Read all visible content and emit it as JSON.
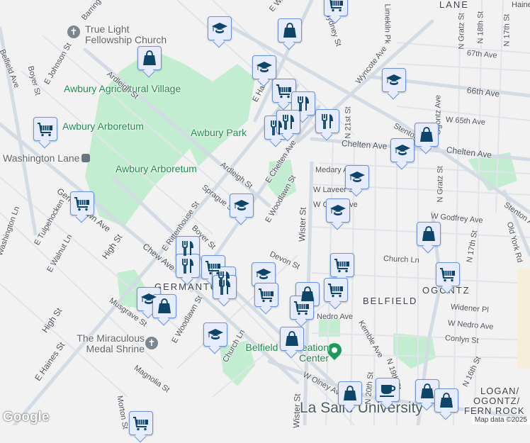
{
  "map": {
    "attribution": "Map data ©2025",
    "logo": "Google",
    "colors": {
      "background": "#f3f2f3",
      "park": "#c3edd0",
      "road": "#d6dde6",
      "marker_fill": "#e6ecfb",
      "marker_border": "#6a93dc",
      "icon": "#0c4568"
    },
    "pois": {
      "church1": "True Light Fellowship Church",
      "church2": "The Miraculous Medal Shrine",
      "rec": "Belfield Recreation Center",
      "station": "Washington Lane",
      "university": "La Salle University"
    },
    "parks": {
      "village": "Awbury Agricultural Village",
      "arboretum1": "Awbury Arboretum",
      "arboretum2": "Awbury Arboretum",
      "park": "Awbury Park"
    },
    "areas": {
      "germantown": "GERMANTOWN",
      "belfield": "BELFIELD",
      "ogontz": "OGONTZ",
      "lane": "LANE",
      "logan1": "LOGAN/",
      "logan2": "OGONTZ/",
      "logan3": "FERN ROCK"
    },
    "streets": {
      "barring": "Barring",
      "ewalnut_top": "E Walnut",
      "sydney": "Sydney St",
      "limekiln": "Limekiln Pk",
      "haines_top": "Haines",
      "belfield": "Belfield Ave",
      "boyer1": "Boyer St",
      "johnson": "E Johnson St",
      "ardleigh1": "Ardleigh St",
      "ardleigh2": "Ardleigh St",
      "sprague": "Sprague St",
      "ehaines1": "E Haines St",
      "echelten": "E Chelten Ave",
      "wyncote": "Wyncote Ave",
      "n21": "N 21st St",
      "chelten1": "Chelten Ave",
      "chelten2": "Chelten Ave",
      "stenton1": "Stenton Ave",
      "stenton2": "Stenton Ave",
      "ave66": "66th Ave",
      "ave67": "67th Ave",
      "w65": "W 65th Ave",
      "ogontz": "Ogontz Ave",
      "gratz1": "N Gratz St",
      "gratz2": "N Gratz St",
      "n18": "N 18th St",
      "n17a": "N 17th St",
      "n17b": "N 17th St",
      "medary": "Medary Ave",
      "laveer": "W Laveer St",
      "wchew": "W Chew Ave",
      "godfrey": "W Godfrey Ave",
      "wister1": "Wister St",
      "wister2": "Wister St",
      "woodlawn1": "E Woodlawn St",
      "oldyork": "Old York Rd",
      "churchln1": "Church Ln",
      "devon": "Devon St",
      "widener": "Widener Pl",
      "wnedro": "W Nedro Ave",
      "nedro": "Nedro Ave",
      "conlyn": "Conlyn St",
      "kemble": "Kemble Ave",
      "n19": "N 19th St",
      "olney": "W Olney Ave",
      "n20": "N 20th St",
      "n16": "N 16th St",
      "rittenhouse": "E Rittenhouse St",
      "boyer2": "Boyer St",
      "chew": "Chew Ave",
      "musgrave": "Musgrave St",
      "woodlawn2": "E Woodlawn St",
      "churchln2": "Church Ln",
      "high1": "High St",
      "high2": "High St",
      "ehaines2": "E Haines St",
      "magnolia": "Magnolia St",
      "morton": "Morton St",
      "walnut": "E Walnut Ln",
      "tulpehocken": "E Tulpehocken",
      "washln": "Washington Ln",
      "germantown_ave": "Germantown Ave"
    },
    "markers": [
      {
        "category": "school"
      },
      {
        "category": "school"
      },
      {
        "category": "school"
      },
      {
        "category": "school"
      },
      {
        "category": "school"
      },
      {
        "category": "school"
      },
      {
        "category": "school"
      },
      {
        "category": "school"
      },
      {
        "category": "school"
      },
      {
        "category": "school"
      },
      {
        "category": "shopping"
      },
      {
        "category": "shopping"
      },
      {
        "category": "shopping"
      },
      {
        "category": "shopping"
      },
      {
        "category": "shopping"
      },
      {
        "category": "shopping"
      },
      {
        "category": "shopping"
      },
      {
        "category": "shopping"
      },
      {
        "category": "shopping"
      },
      {
        "category": "shopping"
      },
      {
        "category": "grocery"
      },
      {
        "category": "grocery"
      },
      {
        "category": "grocery"
      },
      {
        "category": "grocery"
      },
      {
        "category": "grocery"
      },
      {
        "category": "grocery"
      },
      {
        "category": "grocery"
      },
      {
        "category": "grocery"
      },
      {
        "category": "grocery"
      },
      {
        "category": "grocery"
      },
      {
        "category": "grocery"
      },
      {
        "category": "restaurant"
      },
      {
        "category": "restaurant"
      },
      {
        "category": "restaurant"
      },
      {
        "category": "restaurant"
      },
      {
        "category": "restaurant"
      },
      {
        "category": "restaurant"
      },
      {
        "category": "restaurant"
      },
      {
        "category": "restaurant"
      },
      {
        "category": "cafe"
      }
    ]
  }
}
